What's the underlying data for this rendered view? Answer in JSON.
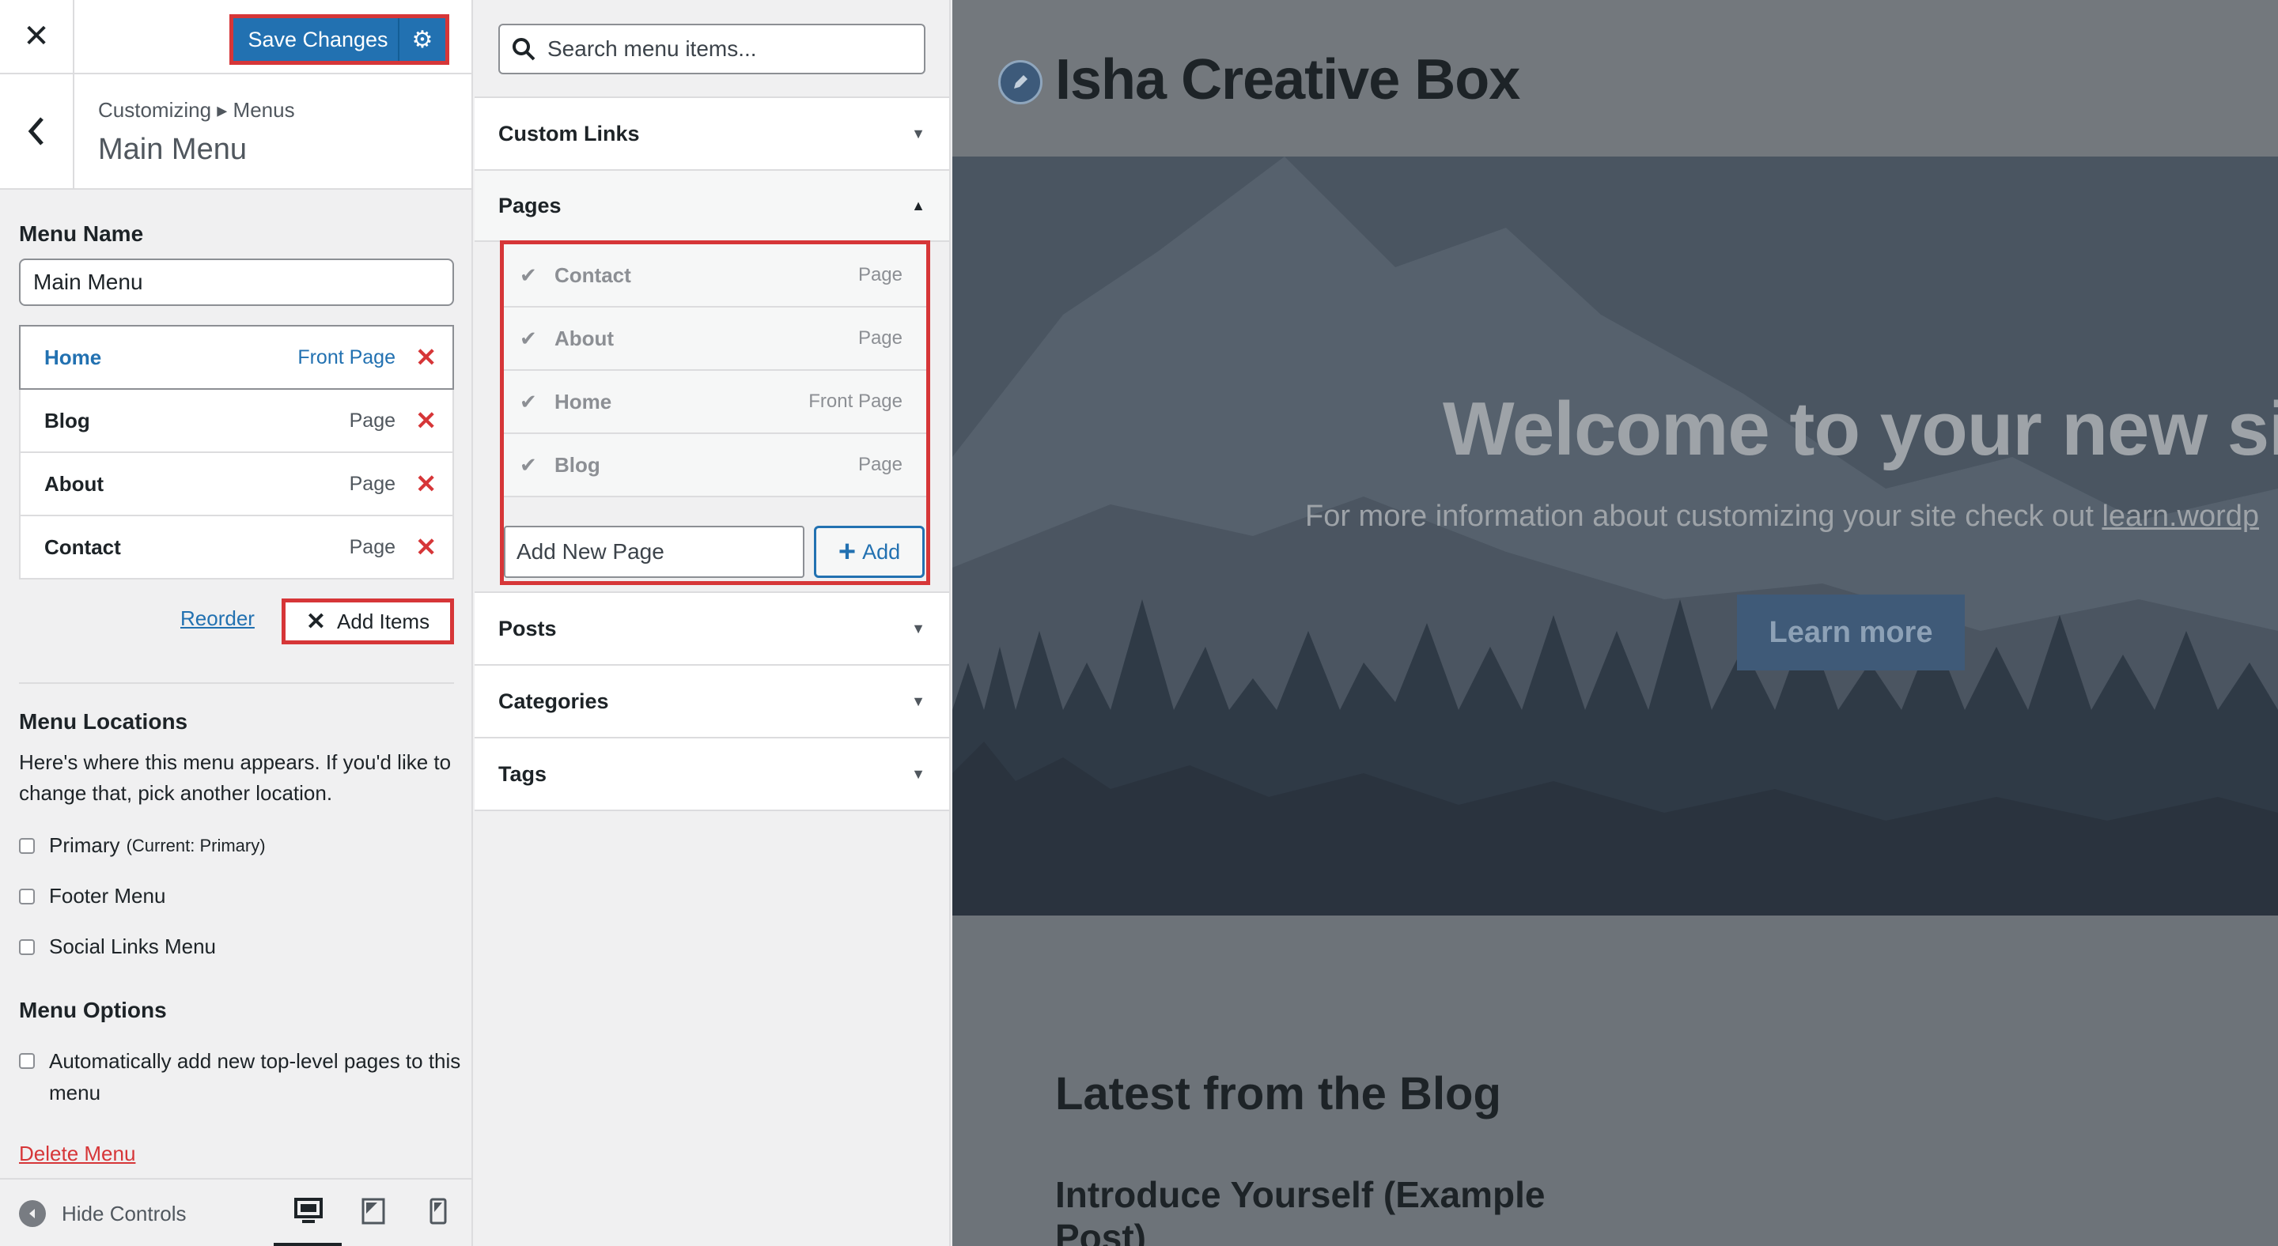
{
  "topbar": {
    "close_icon": "close-icon",
    "save_label": "Save Changes",
    "settings_icon": "gear-icon"
  },
  "section": {
    "breadcrumb": "Customizing ▸ Menus",
    "title": "Main Menu"
  },
  "menu_name": {
    "label": "Menu Name",
    "value": "Main Menu"
  },
  "menu_items": [
    {
      "title": "Home",
      "type": "Front Page"
    },
    {
      "title": "Blog",
      "type": "Page"
    },
    {
      "title": "About",
      "type": "Page"
    },
    {
      "title": "Contact",
      "type": "Page"
    }
  ],
  "actions": {
    "reorder": "Reorder",
    "add_items": "Add Items"
  },
  "locations": {
    "title": "Menu Locations",
    "description": "Here's where this menu appears. If you'd like to change that, pick another location.",
    "primary": "Primary",
    "primary_note": "(Current: Primary)",
    "footer": "Footer Menu",
    "social": "Social Links Menu"
  },
  "options": {
    "title": "Menu Options",
    "auto_add": "Automatically add new top-level pages to this menu"
  },
  "delete_menu": "Delete Menu",
  "footer": {
    "hide_controls": "Hide Controls"
  },
  "search": {
    "placeholder": "Search menu items..."
  },
  "accordions": {
    "custom_links": "Custom Links",
    "pages": "Pages",
    "posts": "Posts",
    "categories": "Categories",
    "tags": "Tags"
  },
  "pages": [
    {
      "title": "Contact",
      "type": "Page"
    },
    {
      "title": "About",
      "type": "Page"
    },
    {
      "title": "Home",
      "type": "Front Page"
    },
    {
      "title": "Blog",
      "type": "Page"
    }
  ],
  "new_page": {
    "placeholder": "Add New Page",
    "add_label": "Add"
  },
  "preview": {
    "site_title": "Isha Creative Box",
    "hero_title": "Welcome to your new site.",
    "hero_sub": "For more information about customizing your site check out ",
    "hero_link": "learn.wordp",
    "hero_button": "Learn more",
    "blog_heading": "Latest from the Blog",
    "post_title": "Introduce Yourself (Example Post)"
  },
  "colors": {
    "accent": "#2271b1",
    "danger": "#d63638",
    "highlight_border": "#d63638"
  }
}
